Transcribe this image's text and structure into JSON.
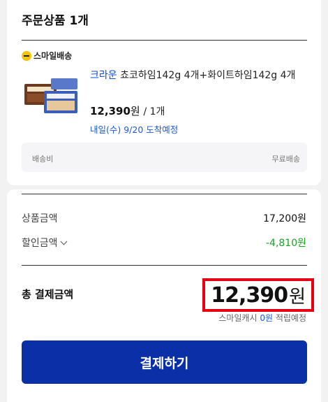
{
  "order": {
    "section_title": "주문상품 1개",
    "delivery_badge": "스마일배송",
    "product": {
      "brand": "크라운",
      "name": "쵸코하임142g 4개+화이트하임142g 4개",
      "price": "12,390",
      "price_unit": "원",
      "qty": "/ 1개",
      "delivery_date": "내일(수) 9/20 도착예정"
    },
    "shipping": {
      "label": "배송비",
      "value": "무료배송"
    }
  },
  "summary": {
    "product_amount_label": "상품금액",
    "product_amount_value": "17,200원",
    "discount_label": "할인금액",
    "discount_value": "-4,810원",
    "total_label": "총 결제금액",
    "total_value": "12,390",
    "total_unit": "원",
    "cash_note_prefix": "스마일캐시",
    "cash_note_amount": "0원",
    "cash_note_suffix": "적립예정",
    "pay_button_label": "결제하기"
  },
  "colors": {
    "accent_blue": "#0a2fa6",
    "link_blue": "#1a5cd7",
    "discount_green": "#1aa224",
    "highlight_red": "#e60012",
    "badge_yellow": "#f9c400"
  },
  "icons": {
    "badge": "smile-delivery-icon",
    "discount_toggle": "chevron-down-icon"
  }
}
